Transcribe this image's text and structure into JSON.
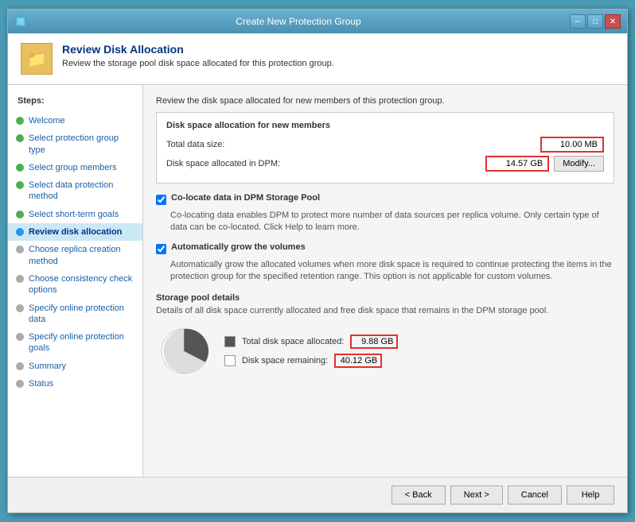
{
  "window": {
    "title": "Create New Protection Group"
  },
  "header": {
    "title": "Review Disk Allocation",
    "subtitle": "Review the storage pool disk space allocated for this protection group."
  },
  "sidebar": {
    "title": "Steps:",
    "items": [
      {
        "id": "welcome",
        "label": "Welcome",
        "status": "green"
      },
      {
        "id": "select-protection-group-type",
        "label": "Select protection group type",
        "status": "green"
      },
      {
        "id": "select-group-members",
        "label": "Select group members",
        "status": "green"
      },
      {
        "id": "select-data-protection",
        "label": "Select data protection method",
        "status": "green"
      },
      {
        "id": "select-short-term",
        "label": "Select short-term goals",
        "status": "green"
      },
      {
        "id": "review-disk-allocation",
        "label": "Review disk allocation",
        "status": "blue",
        "active": true
      },
      {
        "id": "choose-replica-creation",
        "label": "Choose replica creation method",
        "status": "gray"
      },
      {
        "id": "choose-consistency-check",
        "label": "Choose consistency check options",
        "status": "gray"
      },
      {
        "id": "specify-online-protection-data",
        "label": "Specify online protection data",
        "status": "gray"
      },
      {
        "id": "specify-online-protection-goals",
        "label": "Specify online protection goals",
        "status": "gray"
      },
      {
        "id": "summary",
        "label": "Summary",
        "status": "gray"
      },
      {
        "id": "status",
        "label": "Status",
        "status": "gray"
      }
    ]
  },
  "main": {
    "section_desc": "Review the disk space allocated for new members of this protection group.",
    "disk_alloc": {
      "title": "Disk space allocation for new members",
      "total_data_label": "Total data size:",
      "total_data_value": "10.00 MB",
      "disk_space_label": "Disk space allocated in DPM:",
      "disk_space_value": "14.57 GB",
      "modify_label": "Modify..."
    },
    "colocate": {
      "label": "Co-locate data in DPM Storage Pool",
      "desc": "Co-locating data enables DPM to protect more number of data sources per replica volume. Only certain type of data can be co-located. Click Help to learn more.",
      "checked": true
    },
    "auto_grow": {
      "label": "Automatically grow the volumes",
      "desc": "Automatically grow the allocated volumes when more disk space is required to continue protecting the items in the protection group for the specified retention range. This option is not applicable for custom volumes.",
      "checked": true
    },
    "storage_pool": {
      "title": "Storage pool details",
      "desc": "Details of all disk space currently allocated and free disk space that remains in the DPM storage pool.",
      "total_allocated_label": "Total disk space allocated:",
      "total_allocated_value": "9.88 GB",
      "disk_remaining_label": "Disk space remaining:",
      "disk_remaining_value": "40.12 GB"
    }
  },
  "footer": {
    "back_label": "< Back",
    "next_label": "Next >",
    "cancel_label": "Cancel",
    "help_label": "Help"
  }
}
